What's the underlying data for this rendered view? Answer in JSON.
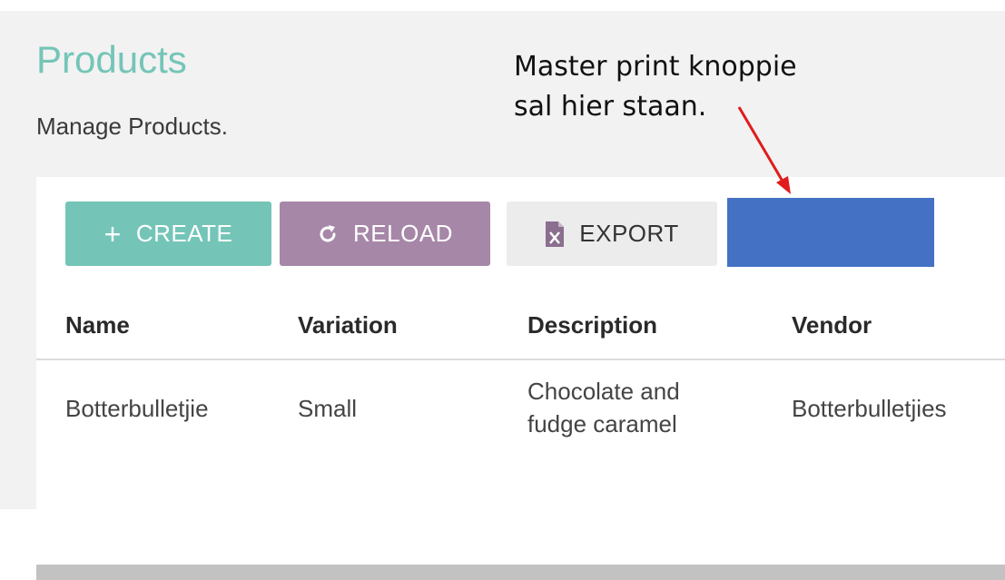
{
  "header": {
    "title": "Products",
    "subtitle": "Manage Products."
  },
  "annotation": {
    "lines": [
      "Master print knoppie",
      "sal hier staan."
    ],
    "arrow_color": "#e01c1c"
  },
  "toolbar": {
    "create_label": "CREATE",
    "create_icon": "plus-icon",
    "reload_label": "RELOAD",
    "reload_icon": "refresh-icon",
    "export_label": "EXPORT",
    "export_icon": "excel-file-icon",
    "print_button_color": "#4471c4"
  },
  "table": {
    "columns": [
      "Name",
      "Variation",
      "Description",
      "Vendor"
    ],
    "rows": [
      {
        "name": "Botterbulletjie",
        "variation": "Small",
        "description": [
          "Chocolate and",
          "fudge caramel"
        ],
        "vendor": "Botterbulletjies"
      }
    ]
  },
  "colors": {
    "accent_teal": "#74c5b7",
    "accent_purple": "#a687a8",
    "export_bg": "#ececec"
  }
}
